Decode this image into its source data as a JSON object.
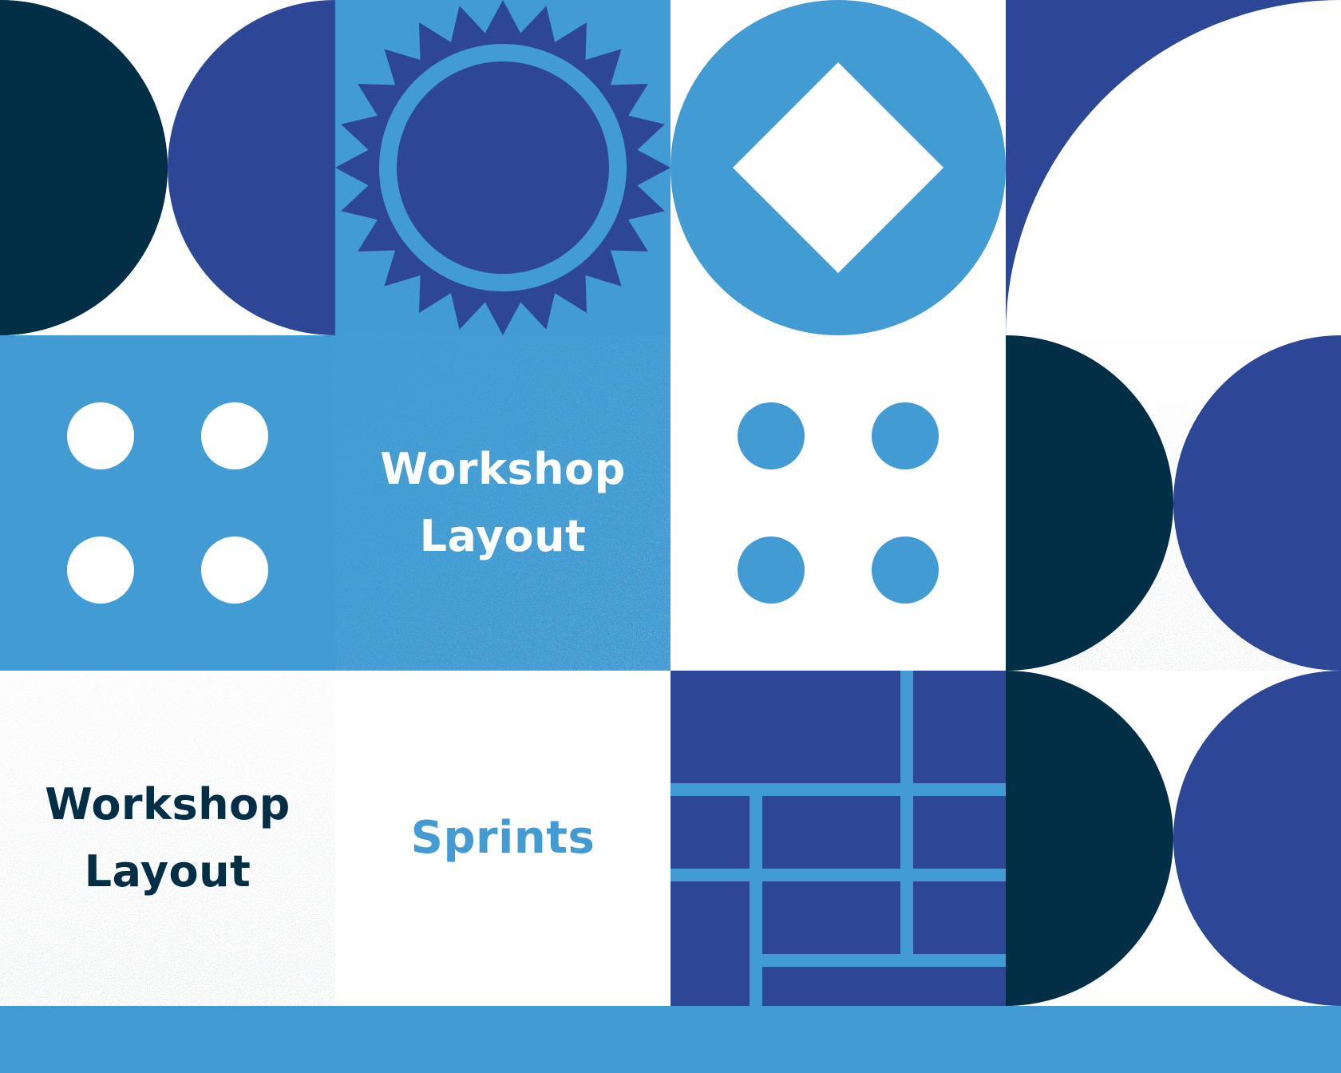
{
  "colors": {
    "navy": "#022f45",
    "royal_blue": "#2d4696",
    "sky_blue": "#429bd2",
    "white": "#ffffff",
    "speckle_grey": "#d7dcdf"
  },
  "tiles": {
    "center_title": {
      "line1": "Workshop",
      "line2": "Layout"
    },
    "left_title": {
      "line1": "Workshop",
      "line2": "Layout"
    },
    "sprints_label": "Sprints"
  }
}
